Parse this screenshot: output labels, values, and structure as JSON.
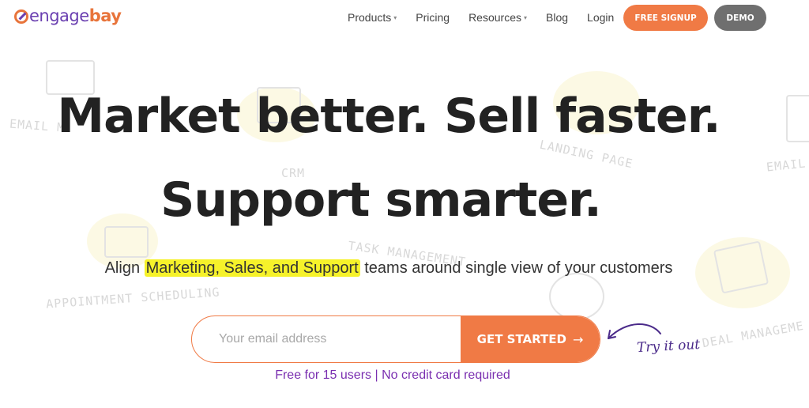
{
  "logo": {
    "part1": "engage",
    "part2": "bay"
  },
  "nav": {
    "items": [
      {
        "label": "Products",
        "caret": "▾"
      },
      {
        "label": "Pricing",
        "caret": ""
      },
      {
        "label": "Resources",
        "caret": "▾"
      },
      {
        "label": "Blog",
        "caret": ""
      },
      {
        "label": "Login",
        "caret": ""
      }
    ],
    "signup_label": "FREE SIGNUP",
    "demo_label": "DEMO"
  },
  "hero": {
    "line1": "Market better. Sell faster.",
    "line2": "Support smarter.",
    "sub_before": "Align ",
    "sub_highlight": "Marketing, Sales, and Support",
    "sub_after": " teams around single view of your customers",
    "email_placeholder": "Your email address",
    "cta_label": "GET STARTED",
    "cta_arrow": "→",
    "try_it": "Try it out",
    "free_note": "Free for 15 users | No credit card required"
  },
  "background_labels": {
    "email_left": "EMAIL M",
    "crm": "CRM",
    "landing_page": "LANDING PAGE",
    "email_right": "EMAIL",
    "task_management": "TASK MANAGEMENT",
    "appointment_scheduling": "APPOINTMENT SCHEDULING",
    "deal_management": "DEAL MANAGEME"
  },
  "colors": {
    "brand_orange": "#f07a45",
    "brand_purple": "#6a3fb0",
    "demo_gray": "#6f6f6f",
    "highlight": "#f6f22a"
  }
}
